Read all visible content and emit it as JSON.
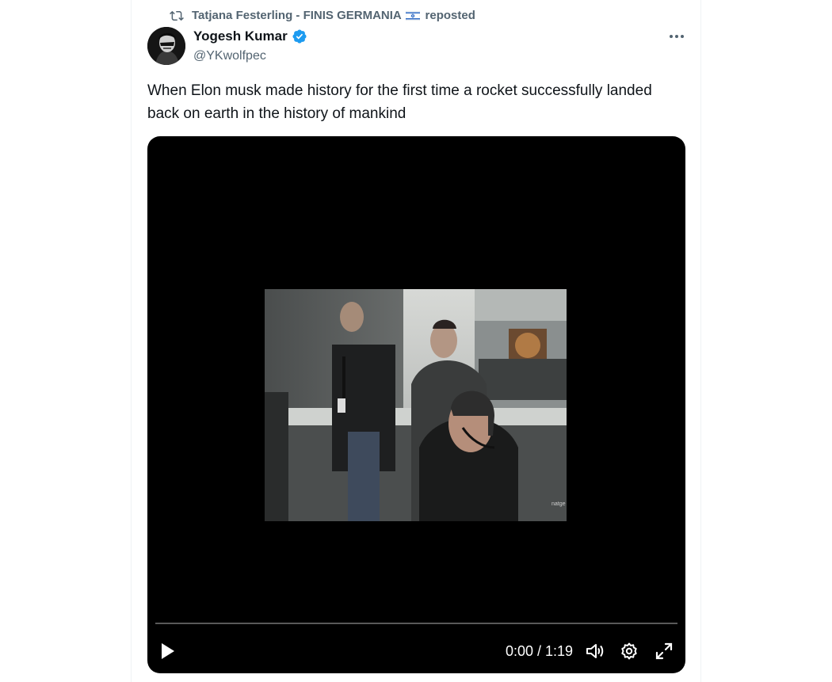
{
  "repost": {
    "reposter_name": "Tatjana Festerling - FINIS GERMANIA",
    "flag_icon": "israel-flag-icon",
    "suffix": "reposted"
  },
  "author": {
    "name": "Yogesh Kumar",
    "handle": "@YKwolfpec",
    "verified": true,
    "verified_color": "#1d9bf0"
  },
  "tweet": {
    "text": "When Elon musk made history for the first time a rocket successfully landed back on earth in the history of mankind"
  },
  "video": {
    "time_display": "0:00 / 1:19",
    "progress": 0,
    "watermark": "natge",
    "controls": {
      "play_icon": "play-icon",
      "volume_icon": "volume-icon",
      "settings_icon": "gear-icon",
      "fullscreen_icon": "fullscreen-icon"
    }
  },
  "colors": {
    "text_primary": "#0f1419",
    "text_secondary": "#536471",
    "accent": "#1d9bf0",
    "media_bg": "#000000"
  }
}
